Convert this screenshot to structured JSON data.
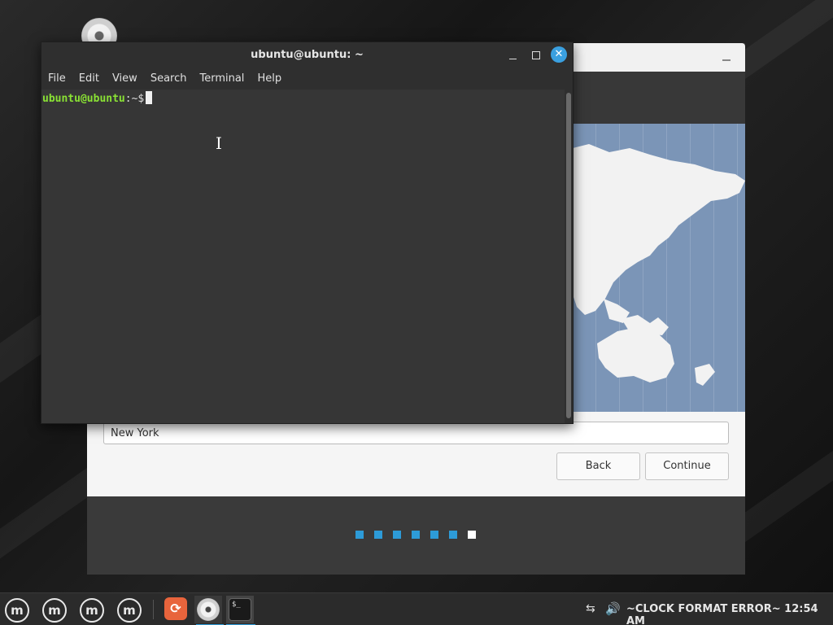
{
  "terminal": {
    "title": "ubuntu@ubuntu: ~",
    "menu": [
      "File",
      "Edit",
      "View",
      "Search",
      "Terminal",
      "Help"
    ],
    "prompt_user": "ubuntu@ubuntu",
    "prompt_path": ":~$",
    "close_glyph": "✕"
  },
  "installer": {
    "timezone_value": "New York",
    "back_label": "Back",
    "continue_label": "Continue",
    "progress_steps_total": 7,
    "progress_current_step": 7
  },
  "taskbar": {
    "menu_glyph": "m",
    "firefox_glyph": "⟳",
    "terminal_glyph": "$_",
    "network_glyph": "⇆",
    "volume_glyph": "🔊",
    "clock": "~CLOCK FORMAT ERROR~ 12:54 AM"
  },
  "colors": {
    "accent": "#2d9bd8",
    "prompt_green": "#8ae234",
    "map_ocean": "#7b95b7"
  }
}
